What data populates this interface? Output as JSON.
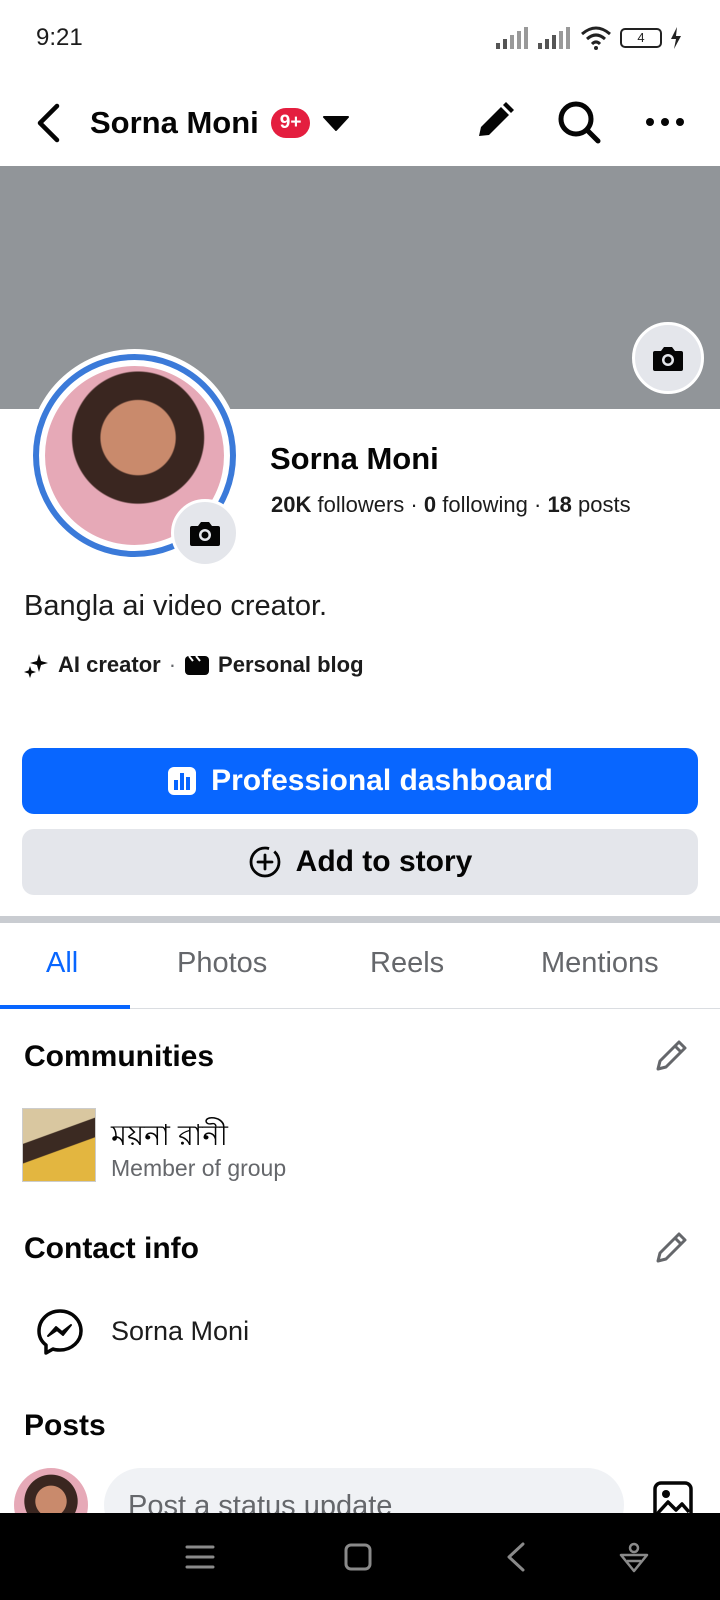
{
  "status_bar": {
    "time": "9:21",
    "battery": "4"
  },
  "top_bar": {
    "title": "Sorna Moni",
    "badge": "9+"
  },
  "profile": {
    "name": "Sorna Moni",
    "followers_count": "20K",
    "followers_label": "followers",
    "following_count": "0",
    "following_label": "following",
    "posts_count": "18",
    "posts_label": "posts",
    "separator": "·",
    "bio": "Bangla ai video creator.",
    "tags": [
      "AI creator",
      "Personal blog"
    ]
  },
  "buttons": {
    "dashboard": "Professional dashboard",
    "add_story": "Add to story"
  },
  "tabs": [
    "All",
    "Photos",
    "Reels",
    "Mentions"
  ],
  "communities": {
    "title": "Communities",
    "item_name": "ময়না রানী",
    "item_sub": "Member of group"
  },
  "contact": {
    "title": "Contact info",
    "messenger_name": "Sorna Moni"
  },
  "posts": {
    "title": "Posts",
    "placeholder": "Post a status update"
  },
  "colors": {
    "primary": "#0866ff",
    "badge": "#e41e3f",
    "cover": "#919599",
    "secondary_bg": "#e4e6eb",
    "avatar_ring": "#3b7ad9"
  }
}
